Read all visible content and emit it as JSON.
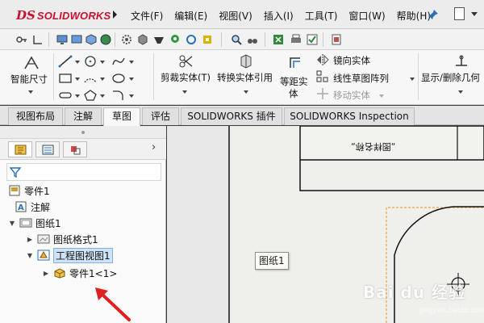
{
  "app": {
    "logo_prefix": "DS",
    "logo_name": "SOLIDWORKS"
  },
  "menu": [
    {
      "label": "文件(F)"
    },
    {
      "label": "编辑(E)"
    },
    {
      "label": "视图(V)"
    },
    {
      "label": "插入(I)"
    },
    {
      "label": "工具(T)"
    },
    {
      "label": "窗口(W)"
    },
    {
      "label": "帮助(H)"
    }
  ],
  "ribbon": {
    "smart_dimension": "智能尺寸",
    "trim_entities": "剪裁实体(T)",
    "convert_entities": "转换实体引用",
    "offset_entities_line1": "等距实",
    "offset_entities_line2": "体",
    "mirror_entities": "镜向实体",
    "linear_pattern": "线性草图阵列",
    "move_entities": "移动实体",
    "display_delete_relations": "显示/删除几何"
  },
  "tabs": [
    {
      "label": "视图布局",
      "active": false
    },
    {
      "label": "注解",
      "active": false
    },
    {
      "label": "草图",
      "active": true
    },
    {
      "label": "评估",
      "active": false
    },
    {
      "label": "SOLIDWORKS 插件",
      "active": false
    },
    {
      "label": "SOLIDWORKS Inspection",
      "active": false
    }
  ],
  "tree": {
    "root": "零件1",
    "annotations": "注解",
    "sheet": "图纸1",
    "sheet_format": "图纸格式1",
    "drawing_view": "工程图视图1",
    "part": "零件1<1>"
  },
  "canvas": {
    "sheet_tooltip": "图纸1",
    "title_text": "„图样名称„"
  },
  "watermark": {
    "text": "Bai du 经验",
    "sub": "jingyan.baidu.com"
  },
  "colors": {
    "logo_red": "#c8102e",
    "selection_blue": "#cfe3f8",
    "orange_dashed": "#f0a040"
  }
}
